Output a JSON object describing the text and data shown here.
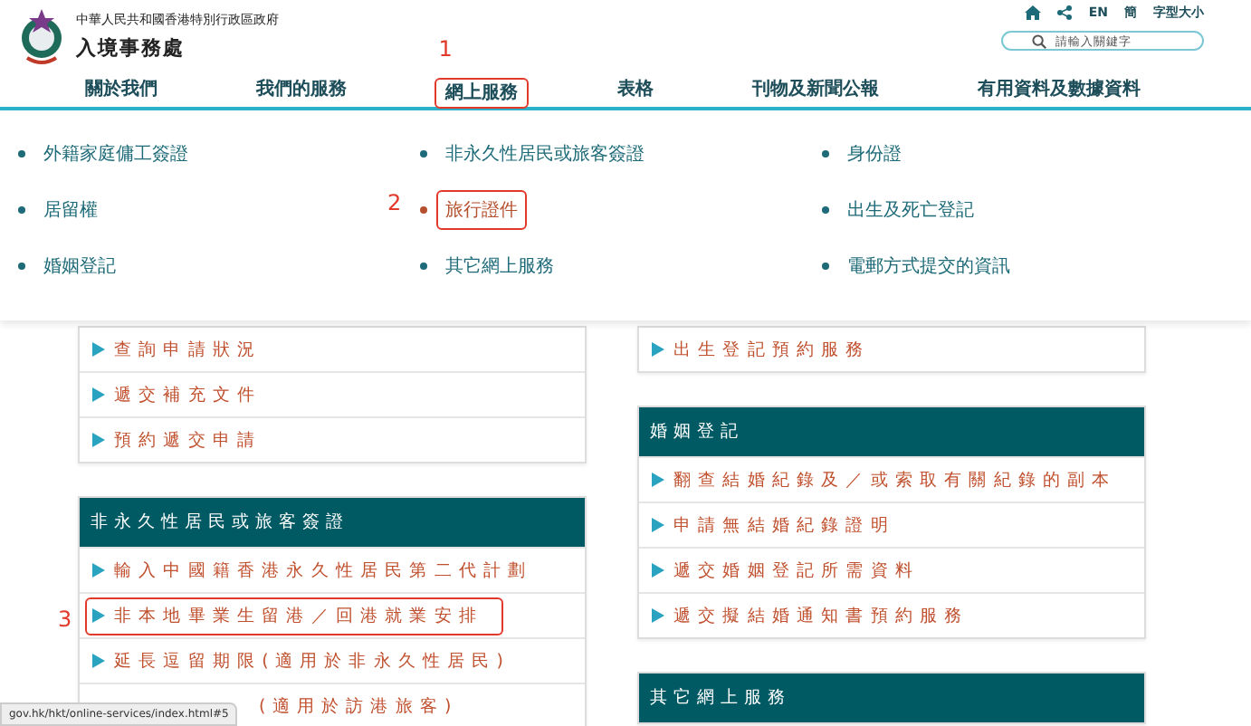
{
  "header": {
    "government": "中華人民共和國香港特別行政區政府",
    "department": "入境事務處",
    "utility_links": [
      {
        "kind": "home"
      },
      {
        "kind": "share"
      },
      {
        "kind": "text",
        "label": "EN"
      },
      {
        "kind": "text",
        "label": "簡"
      },
      {
        "kind": "text",
        "label": "字型大小"
      }
    ]
  },
  "search": {
    "placeholder": "請輸入關鍵字"
  },
  "nav": [
    {
      "label": "關於我們"
    },
    {
      "label": "我們的服務"
    },
    {
      "label": "網上服務",
      "callout": "1"
    },
    {
      "label": "表格"
    },
    {
      "label": "刊物及新聞公報"
    },
    {
      "label": "有用資料及數據資料"
    }
  ],
  "dropdown": {
    "columns": [
      [
        {
          "label": "外籍家庭傭工簽證",
          "highlighted": false
        },
        {
          "label": "居留權",
          "highlighted": false
        },
        {
          "label": "婚姻登記",
          "highlighted": false
        }
      ],
      [
        {
          "label": "非永久性居民或旅客簽證",
          "highlighted": false
        },
        {
          "label": "旅行證件",
          "highlighted": true,
          "callout": "2"
        },
        {
          "label": "其它網上服務",
          "highlighted": false
        }
      ],
      [
        {
          "label": "身份證",
          "highlighted": false
        },
        {
          "label": "出生及死亡登記",
          "highlighted": false
        },
        {
          "label": "電郵方式提交的資訊",
          "highlighted": false
        }
      ]
    ]
  },
  "left_column": [
    {
      "kind": "list",
      "rows": [
        {
          "label": "查詢申請狀況"
        },
        {
          "label": "遞交補充文件"
        },
        {
          "label": "預約遞交申請"
        }
      ]
    },
    {
      "kind": "section",
      "title": "非永久性居民或旅客簽證",
      "rows": [
        {
          "label": "輸入中國籍香港永久性居民第二代計劃"
        },
        {
          "label": "非本地畢業生留港／回港就業安排",
          "callout": "3"
        },
        {
          "label": "延長逗留期限(適用於非永久性居民)"
        },
        {
          "label": "(適用於訪港旅客)",
          "kind": "partial"
        }
      ]
    }
  ],
  "right_column": [
    {
      "kind": "list",
      "rows": [
        {
          "label": "出生登記預約服務"
        }
      ]
    },
    {
      "kind": "section",
      "title": "婚姻登記",
      "rows": [
        {
          "label": "翻查結婚紀錄及／或索取有關紀錄的副本"
        },
        {
          "label": "申請無結婚紀錄證明"
        },
        {
          "label": "遞交婚姻登記所需資料"
        },
        {
          "label": "遞交擬結婚通知書預約服務"
        }
      ]
    },
    {
      "kind": "section",
      "title": "其它網上服務"
    }
  ],
  "status_bar": {
    "url": "gov.hk/hkt/online-services/index.html#5"
  }
}
